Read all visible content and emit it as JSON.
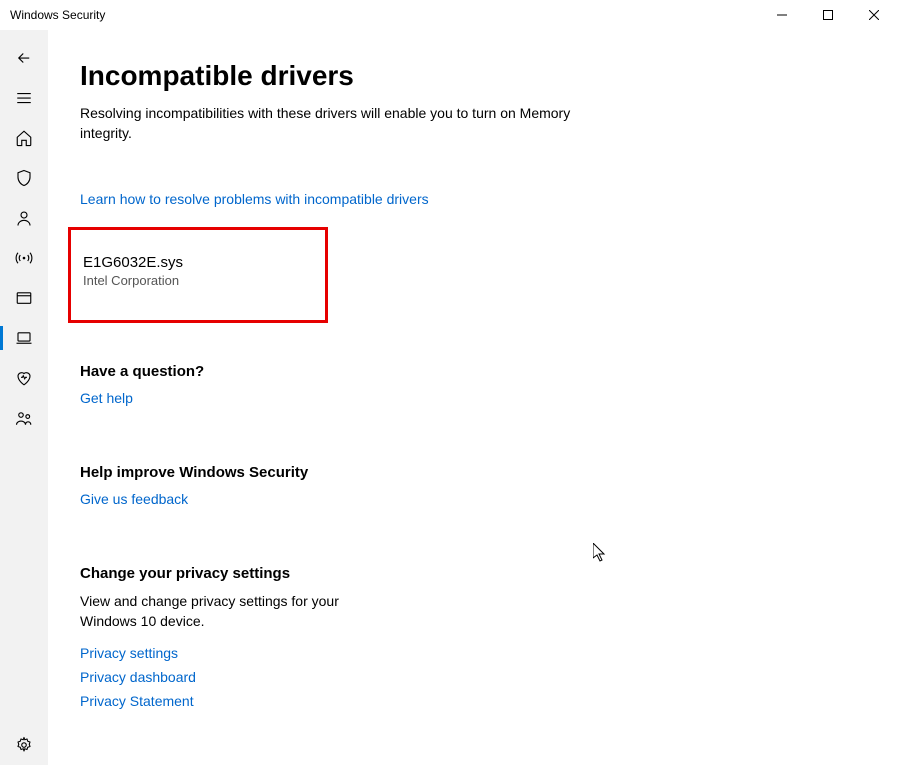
{
  "window": {
    "title": "Windows Security"
  },
  "page": {
    "title": "Incompatible drivers",
    "description": "Resolving incompatibilities with these drivers will enable you to turn on Memory integrity.",
    "learn_link": "Learn how to resolve problems with incompatible drivers"
  },
  "driver": {
    "filename": "E1G6032E.sys",
    "vendor": "Intel Corporation"
  },
  "question": {
    "title": "Have a question?",
    "link": "Get help"
  },
  "improve": {
    "title": "Help improve Windows Security",
    "link": "Give us feedback"
  },
  "privacy": {
    "title": "Change your privacy settings",
    "description": "View and change privacy settings for your Windows 10 device.",
    "links": {
      "settings": "Privacy settings",
      "dashboard": "Privacy dashboard",
      "statement": "Privacy Statement"
    }
  }
}
